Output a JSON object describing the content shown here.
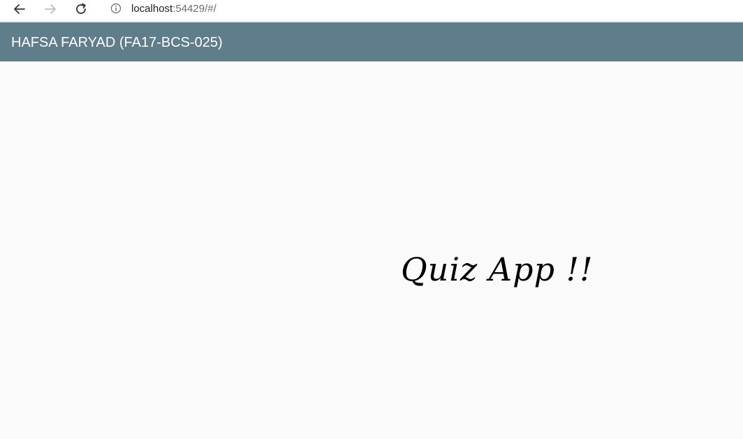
{
  "browser": {
    "url_host": "localhost",
    "url_path": ":54429/#/",
    "icons": {
      "back": "arrow-left-icon",
      "forward": "arrow-right-icon",
      "reload": "reload-icon",
      "info": "info-icon"
    }
  },
  "app_bar": {
    "title": "HAFSA FARYAD (FA17-BCS-025)",
    "color": "#607d8b"
  },
  "main": {
    "heading": "Quiz App !!"
  }
}
